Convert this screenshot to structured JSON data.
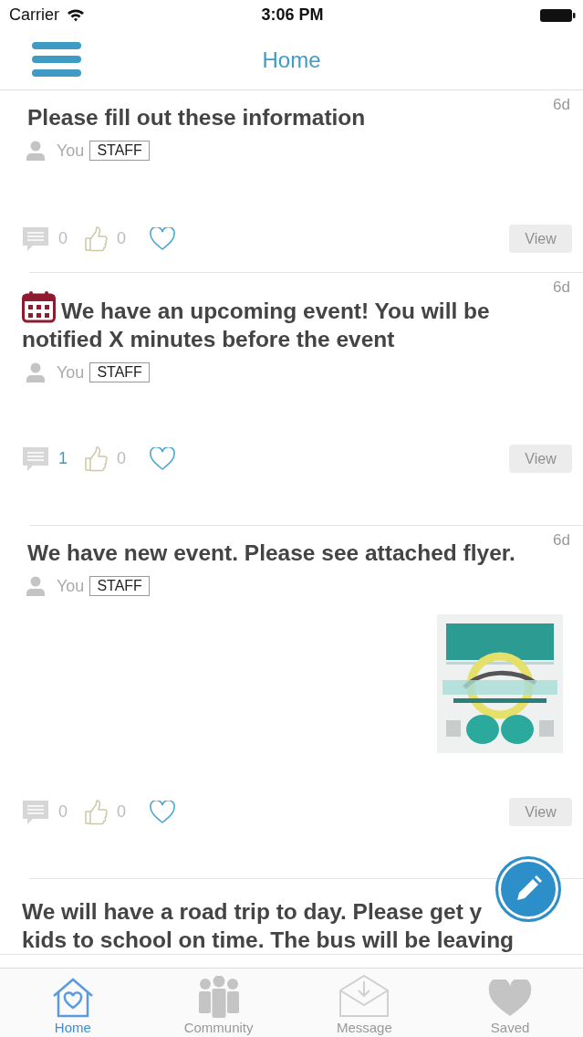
{
  "status_bar": {
    "carrier": "Carrier",
    "time": "3:06 PM"
  },
  "nav": {
    "title": "Home"
  },
  "posts": [
    {
      "time": "6d",
      "event": false,
      "lines": [
        "Please fill out these information"
      ],
      "author": "You",
      "role": "STAFF",
      "comments": {
        "count": "0",
        "highlighted": false
      },
      "likes": "0",
      "saved": false,
      "view": {
        "label": "View",
        "disabled": true
      }
    },
    {
      "time": "6d",
      "event": true,
      "lines": [
        "We have an upcoming event! You will be",
        "notified X minutes before the event"
      ],
      "author": "You",
      "role": "STAFF",
      "comments": {
        "count": "1",
        "highlighted": true
      },
      "likes": "0",
      "saved": false,
      "view": {
        "label": "View",
        "disabled": true
      }
    },
    {
      "time": "6d",
      "event": false,
      "lines": [
        "We have new event. Please see attached flyer."
      ],
      "author": "You",
      "role": "STAFF",
      "attachment": {
        "kind": "picture"
      },
      "comments": {
        "count": "0",
        "highlighted": false
      },
      "likes": "0",
      "saved": false,
      "view": {
        "label": "View",
        "disabled": true
      }
    },
    {
      "event": false,
      "lines": [
        " We will have a road trip to day. Please get y",
        "kids to school on time. The bus will be leaving"
      ]
    }
  ],
  "tabs": [
    {
      "label": "Home",
      "selected": true,
      "kind": "home"
    },
    {
      "label": "Community",
      "selected": false,
      "kind": "community"
    },
    {
      "label": "Message",
      "selected": false,
      "kind": "message"
    },
    {
      "label": "Saved",
      "selected": false,
      "kind": "saved"
    }
  ]
}
